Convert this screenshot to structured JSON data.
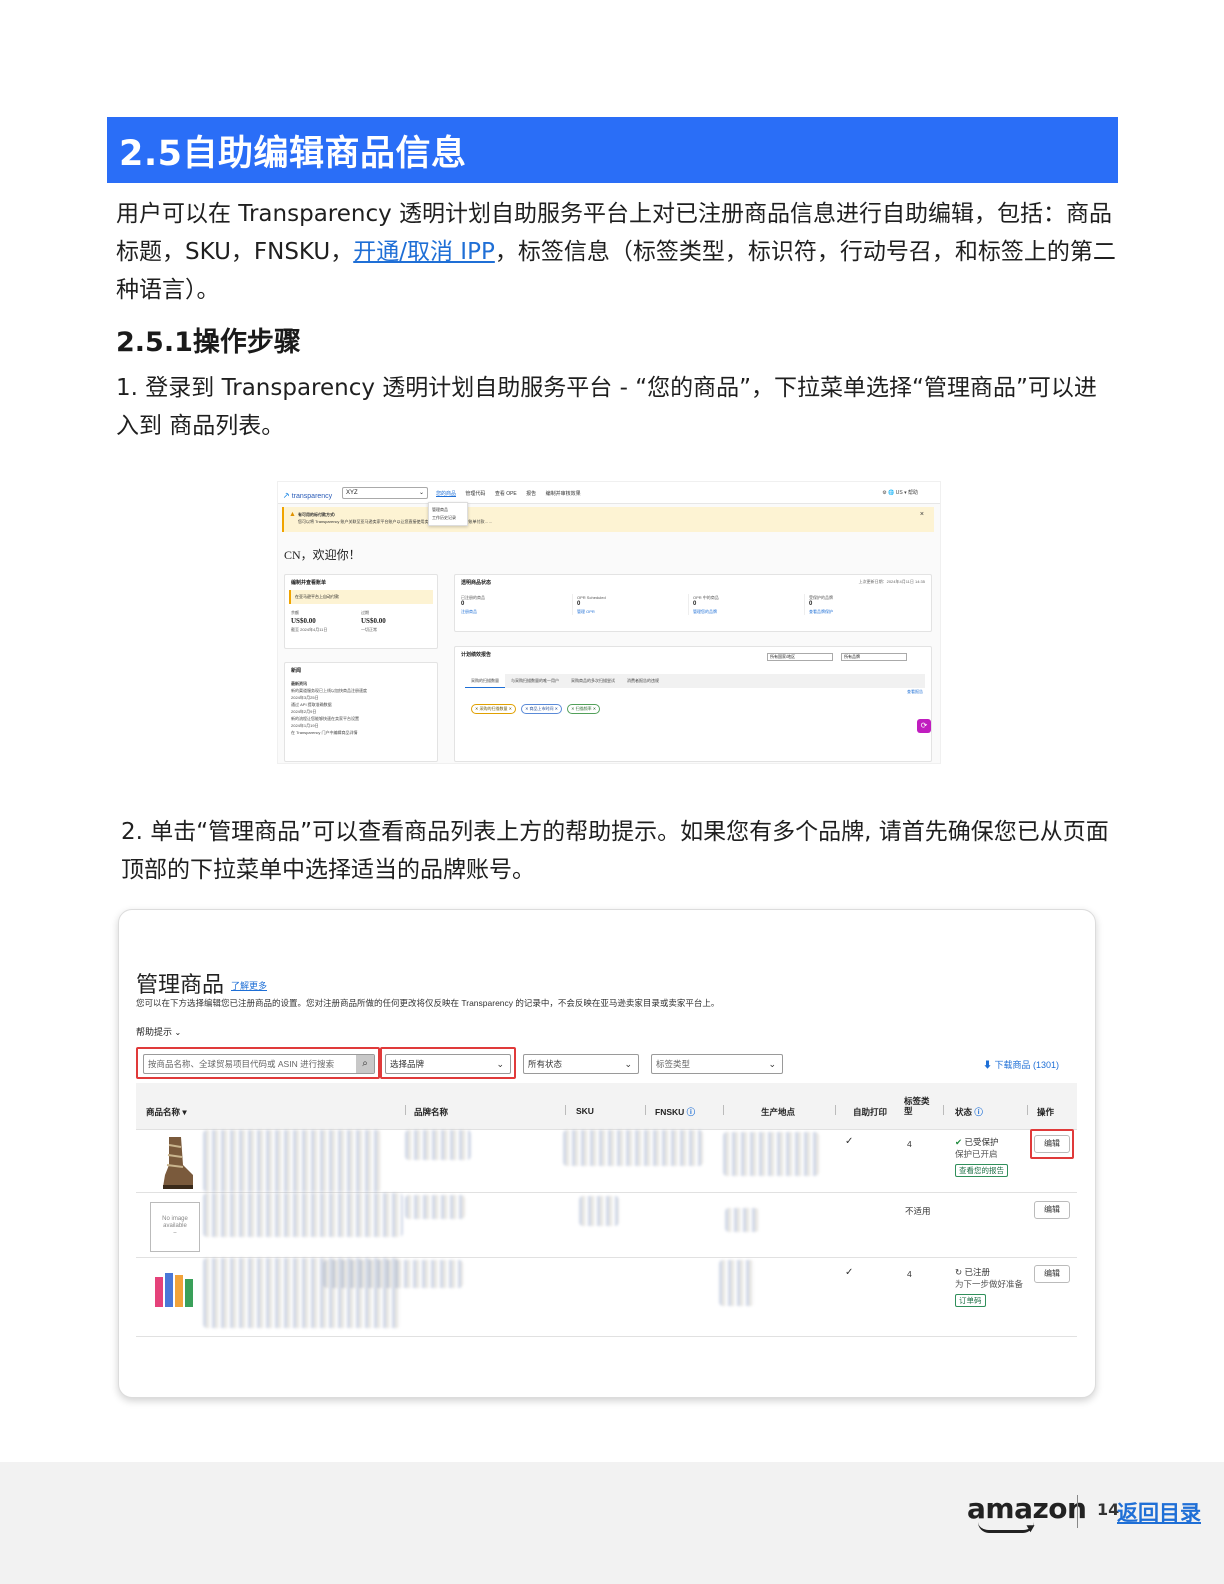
{
  "section": {
    "title": "2.5自助编辑商品信息"
  },
  "intro": {
    "before": "用户可以在 Transparency 透明计划自助服务平台上对已注册商品信息进行自助编辑，包括：商品标题，SKU，FNSKU，",
    "link": "开通/取消 IPP",
    "after": "，标签信息（标签类型，标识符，行动号召，和标签上的第二种语言）。"
  },
  "subsection": {
    "title": "2.5.1操作步骤"
  },
  "step1": {
    "text": "1. 登录到 Transparency 透明计划自助服务平台 - “您的商品”，下拉菜单选择“管理商品”可以进入到 商品列表。"
  },
  "step2": {
    "text": "2. 单击“管理商品”可以查看商品列表上方的帮助提示。如果您有多个品牌, 请首先确保您已从页面顶部的下拉菜单中选择适当的品牌账号。"
  },
  "dashboard": {
    "logo": "transparency",
    "brand_select": "XYZ",
    "nav": [
      "您的商品",
      "管理代码",
      "查看 OPE",
      "报告",
      "编制并审核效果"
    ],
    "right": "⚙  🌐 US ▾   帮助",
    "dropdown": [
      "管理商品",
      "工作历史记录"
    ],
    "alert_title": "有可用的标付款方式!",
    "alert_body": "您可以将 Transparency 账户关联至亚马逊卖家平台账户以让您直接使用卖家平台付款，从而无需账单付款……",
    "welcome": "CN，欢迎你！",
    "card1": {
      "title": "编制并查看账单",
      "warn": "在亚马逊平台上自动付款",
      "left_label": "余额",
      "left_value": "US$0.00",
      "left_note": "截至 2024年4月11日",
      "right_label": "过期",
      "right_value": "US$0.00",
      "right_note": "一切正常"
    },
    "card2": {
      "title": "透明商品状态",
      "updated": "上次更新日期：2024年4月11日 14:35",
      "stats": [
        {
          "label": "已注册的商品",
          "value": "0",
          "link": "注册商品"
        },
        {
          "label": "OPR Scheduled",
          "value": "0",
          "link": "管理 OPR"
        },
        {
          "label": "OPR 中的商品",
          "value": "0",
          "link": "管理您的品牌"
        },
        {
          "label": "受保护的品牌",
          "value": "0",
          "link": "查看品牌保护"
        }
      ]
    },
    "card3": {
      "title": "新闻",
      "items": [
        "最新资讯",
        "新的渠道服务现已上线以加快商品注册速度",
        "2024年3月25日",
        "通过 API 提取准确数据",
        "2024年2月9日",
        "新的流程让您能够快速在卖家平台设置",
        "2024年1月19日",
        "在 Transparency 门户中编辑商品详情"
      ]
    },
    "card4": {
      "title": "计划绩效报告",
      "select_a": "所有国家/地区",
      "select_b": "所有品牌",
      "tabs": [
        "采购的扫描数量",
        "与采购扫描数量的唯一用户",
        "采购商品的多次扫描尝试",
        "消费者报告的违规"
      ],
      "pills": [
        "✕ 采购的扫描数量 ✕",
        "✕ 商品上市时间 ✕",
        "✕ 扫描频率 ✕"
      ],
      "link": "查看报告"
    }
  },
  "manage": {
    "title": "管理商品",
    "learn_more": "了解更多",
    "description": "您可以在下方选择编辑您已注册商品的设置。您对注册商品所做的任何更改将仅反映在 Transparency 的记录中，不会反映在亚马逊卖家目录或卖家平台上。",
    "help": "帮助提示",
    "search_placeholder": "按商品名称、全球贸易项目代码或 ASIN 进行搜索",
    "brand_select": "选择品牌",
    "status_select": "所有状态",
    "label_select": "标签类型",
    "download": "⬇ 下载商品 (1301)",
    "columns": {
      "name": "商品名称 ▾",
      "brand": "品牌名称",
      "sku": "SKU",
      "fnsku": "FNSKU",
      "origin": "生产地点",
      "self_print": "自助打印",
      "label_type_1": "标签类",
      "label_type_2": "型",
      "status": "状态",
      "action": "操作"
    },
    "rows": [
      {
        "self_print": "✓",
        "label_count": "4",
        "status": "已受保护",
        "status_sub": "保护已开启",
        "status_btn": "查看您的报告",
        "action": "编辑"
      },
      {
        "na": "不适用",
        "action": "编辑",
        "noimage": "No image available"
      },
      {
        "self_print": "✓",
        "label_count": "4",
        "status": "已注册",
        "status_sub": "为下一步做好准备",
        "status_btn": "订单码",
        "action": "编辑"
      }
    ]
  },
  "footer": {
    "logo": "amazon",
    "page": "14",
    "toc": "返回目录"
  },
  "colors": {
    "header_blue": "#2a6ef7",
    "link_blue": "#1f6fd6",
    "highlight_red": "#e03a3a"
  }
}
